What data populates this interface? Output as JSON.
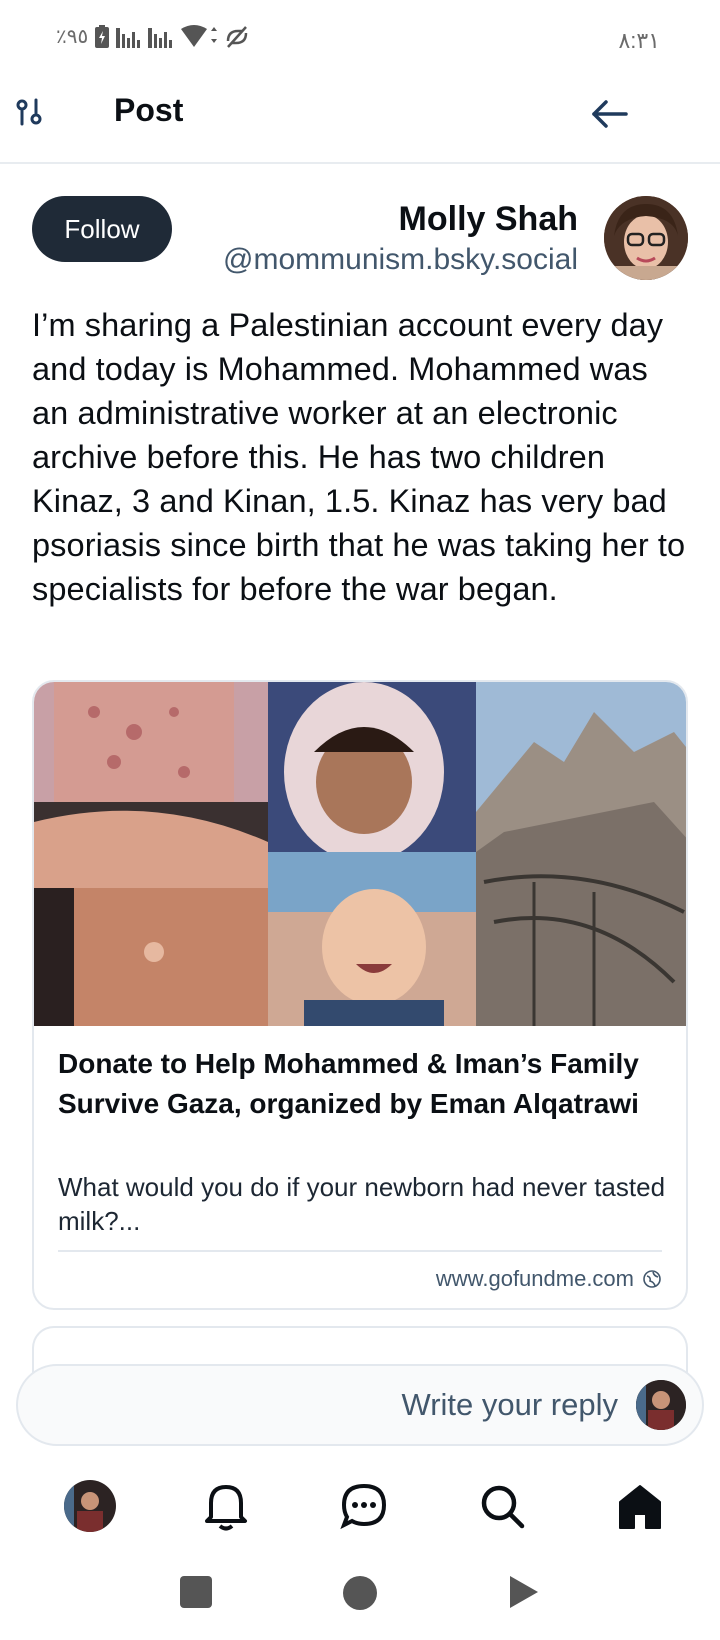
{
  "status_bar": {
    "battery": "٪۹٥",
    "time": "۸:۳۱"
  },
  "header": {
    "title": "Post",
    "icons": [
      "sliders-icon",
      "back-arrow-icon"
    ]
  },
  "post": {
    "follow_label": "Follow",
    "author_name": "Molly Shah",
    "author_handle": "@mommunism.bsky.social",
    "text": "I’m sharing a Palestinian account every day and today is Mohammed. Mohammed was an administrative worker at an electronic archive before this. He has two children Kinaz, 3 and Kinan, 1.5. Kinaz has very bad psoriasis since birth that he was taking her to specialists for before the war began."
  },
  "link_card": {
    "title": "Donate to Help Mohammed & Iman’s Family Survive Gaza, organized by Eman Alqatrawi",
    "description": "What would you do if your newborn had never tasted milk?...",
    "domain": "www.gofundme.com"
  },
  "reply": {
    "placeholder": "Write your reply"
  },
  "bottom_nav": {
    "items": [
      "profile-avatar",
      "bell-icon",
      "chat-icon",
      "search-icon",
      "home-icon"
    ]
  },
  "system_nav": {
    "items": [
      "recents-square-icon",
      "home-circle-icon",
      "back-triangle-icon"
    ]
  }
}
